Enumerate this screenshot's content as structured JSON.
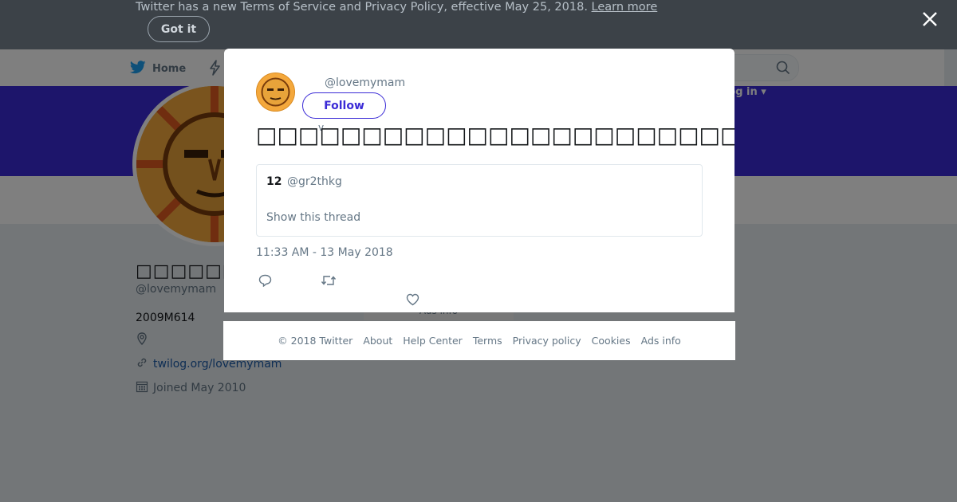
{
  "terms_bar": {
    "message": "Twitter has a new Terms of Service and Privacy Policy, effective May 25, 2018.",
    "learn_more": "Learn more",
    "got_it": "Got it"
  },
  "nav": {
    "home": "Home",
    "login": "Log in"
  },
  "profile": {
    "name": "□□□□□□□",
    "handle": "@lovemymam",
    "bio": "2009M614",
    "link": "twilog.org/lovemymam",
    "joined": "Joined May 2010",
    "ads_fragment": "Ads info"
  },
  "modal": {
    "handle": "@lovemymam",
    "follow": "Follow",
    "tweet_text": "□□□□□□□□□□□□□□□□□□□□□□□□□□□□□□□□□□□□□□□□",
    "quote": {
      "name": "12",
      "handle": "@gr2thkg",
      "show_thread": "Show this thread"
    },
    "timestamp": "11:33 AM - 13 May 2018"
  },
  "footer": {
    "links": [
      "© 2018 Twitter",
      "About",
      "Help Center",
      "Terms",
      "Privacy policy",
      "Cookies",
      "Ads info"
    ]
  },
  "colors": {
    "brand_banner": "#3b2bd6",
    "twitter_blue": "#1da1f2",
    "overlay": "rgba(0,0,0,0.5)"
  },
  "icons": [
    "twitter-bird-icon",
    "lightning-icon",
    "search-icon",
    "close-icon",
    "location-icon",
    "link-icon",
    "calendar-icon",
    "reply-icon",
    "retweet-icon",
    "like-icon",
    "chevron-down-icon"
  ]
}
